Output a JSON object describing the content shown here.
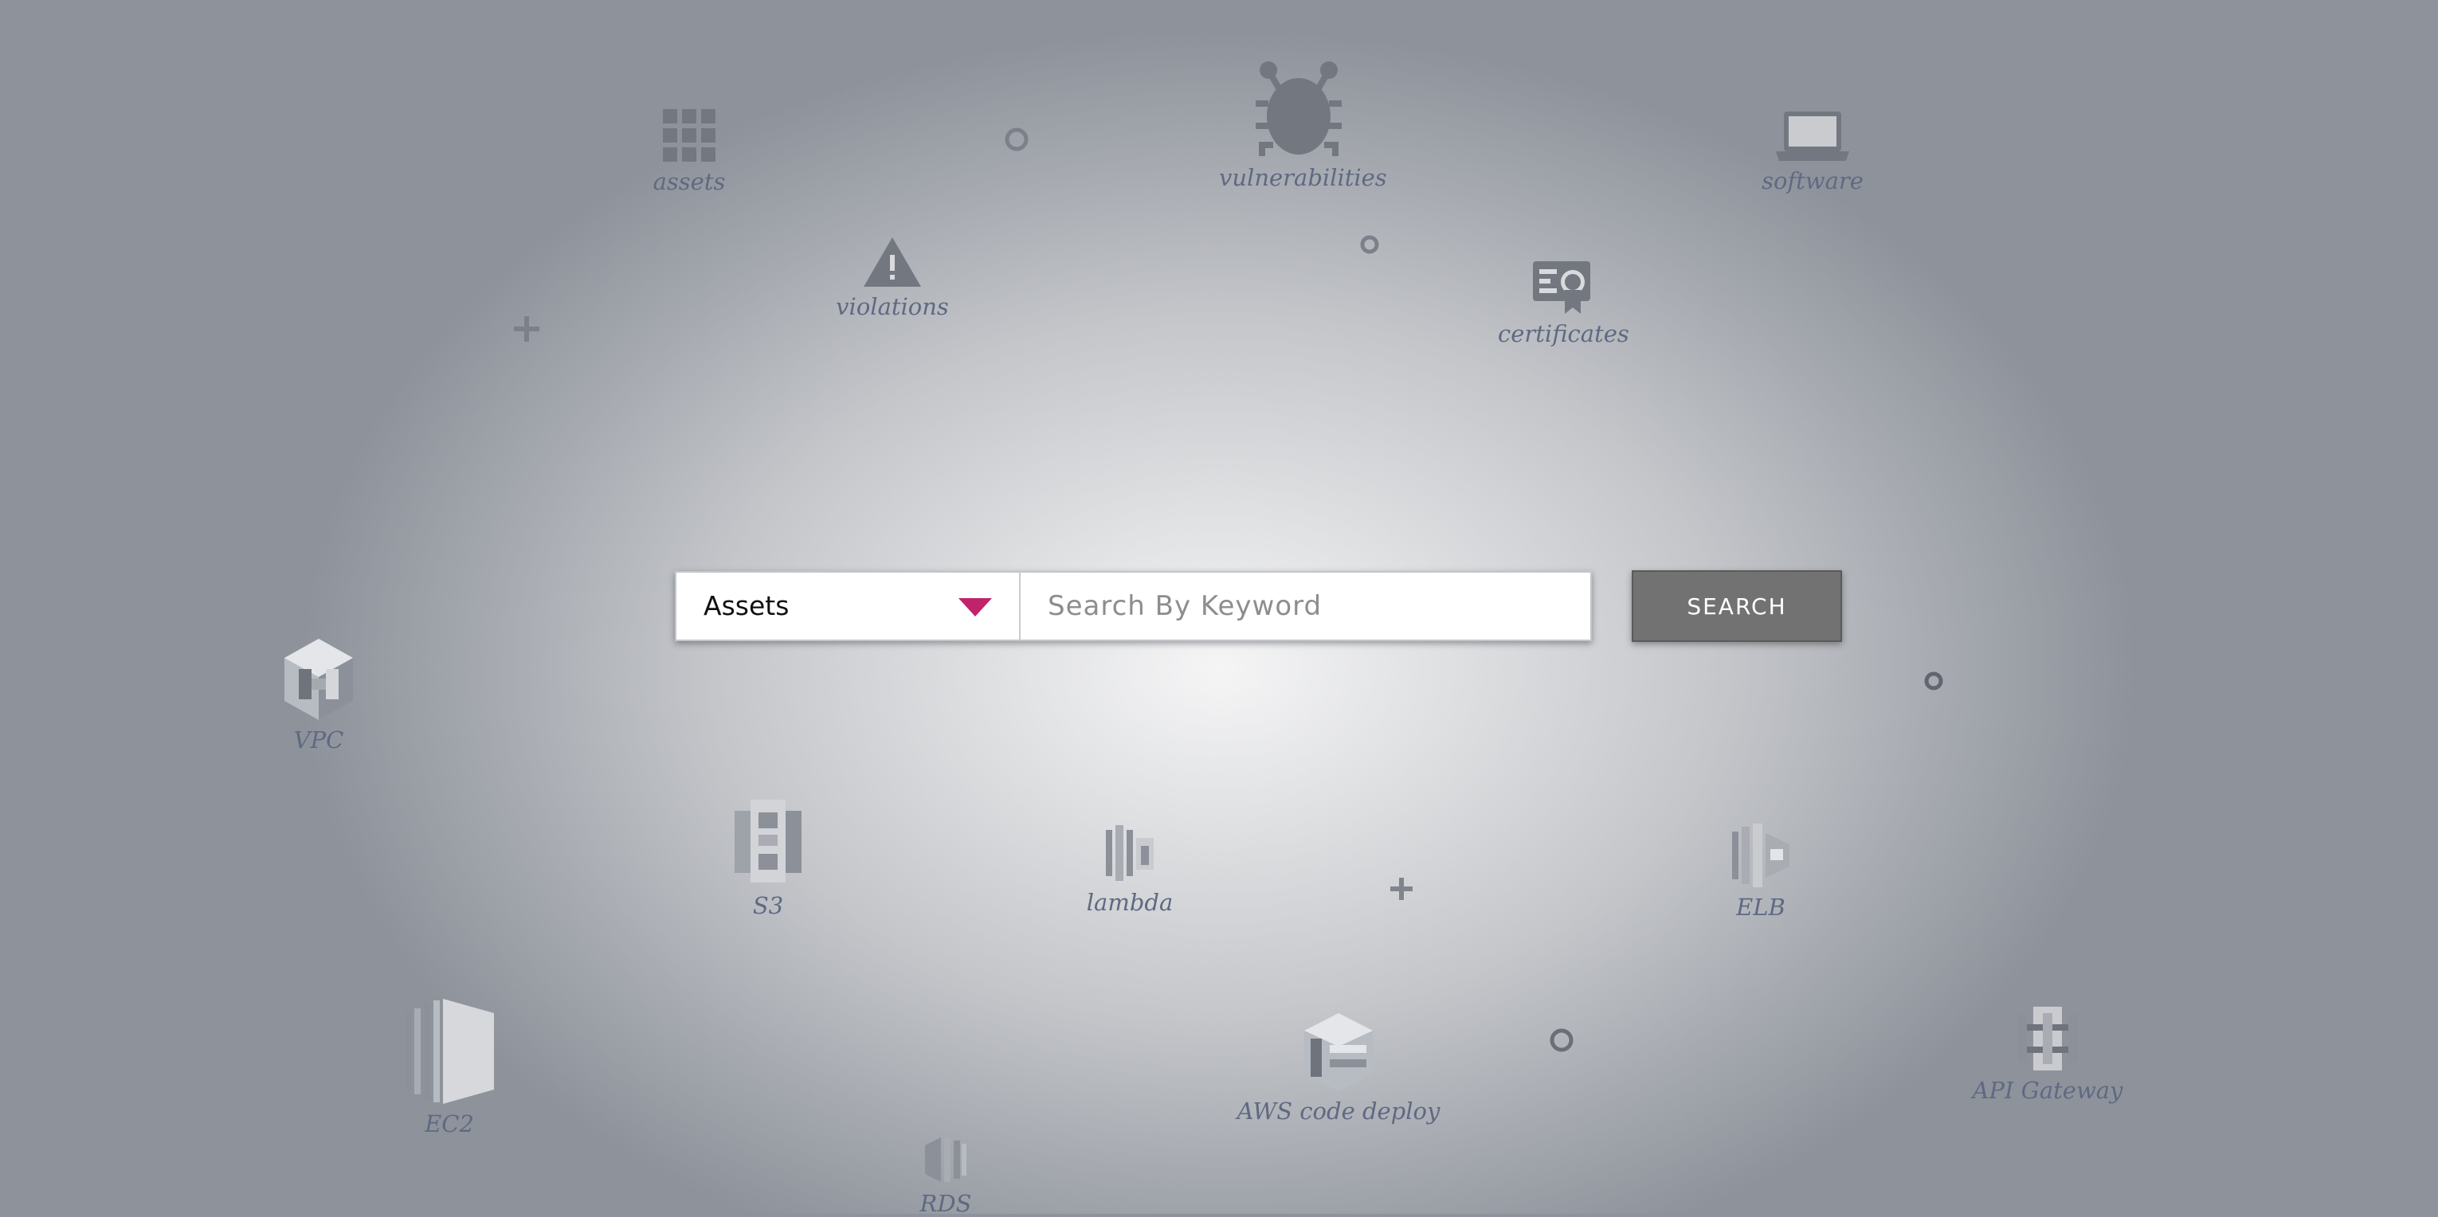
{
  "search": {
    "category_value": "Assets",
    "keyword_placeholder": "Search By Keyword",
    "button_label": "SEARCH"
  },
  "colors": {
    "dropdown_arrow": "#c0236b",
    "search_button": "#727272",
    "label_text": "#5f6982",
    "icon_gray": "#737880"
  },
  "categories": {
    "assets": "assets",
    "violations": "violations",
    "vulnerabilities": "vulnerabilities",
    "certificates": "certificates",
    "software": "software"
  },
  "services": {
    "vpc": "VPC",
    "s3": "S3",
    "lambda": "lambda",
    "elb": "ELB",
    "ec2": "EC2",
    "code_deploy": "AWS code deploy",
    "api_gateway": "API Gateway",
    "rds": "RDS"
  }
}
